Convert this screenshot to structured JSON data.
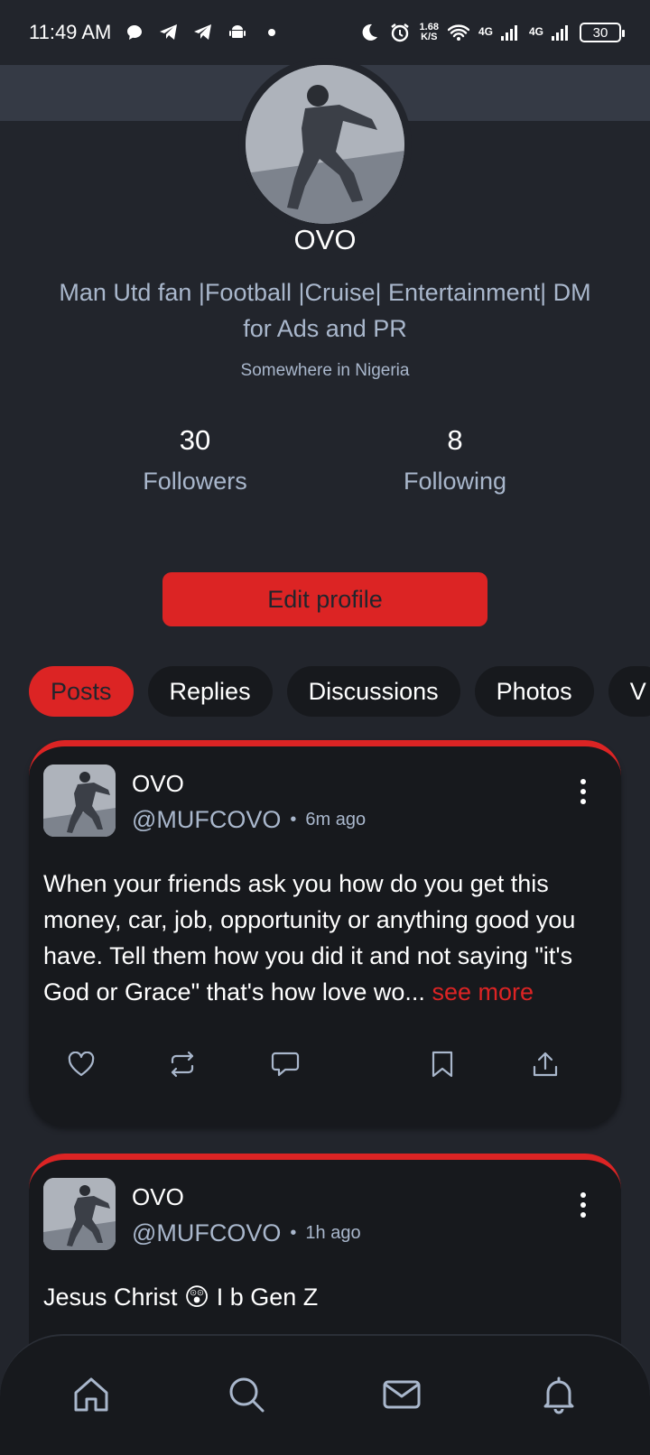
{
  "status_bar": {
    "time": "11:49 AM",
    "net_speed_value": "1.68",
    "net_speed_unit": "K/S",
    "sig1_label": "4G",
    "sig2_label": "4G",
    "battery": "30"
  },
  "profile": {
    "name": "OVO",
    "bio": "Man Utd fan |Football |Cruise| Entertainment| DM for Ads and PR",
    "location": "Somewhere in Nigeria",
    "followers_count": "30",
    "followers_label": "Followers",
    "following_count": "8",
    "following_label": "Following",
    "edit_label": "Edit profile"
  },
  "tabs": [
    {
      "label": "Posts",
      "active": true
    },
    {
      "label": "Replies",
      "active": false
    },
    {
      "label": "Discussions",
      "active": false
    },
    {
      "label": "Photos",
      "active": false
    },
    {
      "label": "V",
      "active": false
    }
  ],
  "posts": [
    {
      "name": "OVO",
      "handle": "@MUFCOVO",
      "separator": "•",
      "time": "6m ago",
      "text": "When your friends ask you how do you get this money, car, job, opportunity or anything good you have. Tell them how you did it and not saying \"it's God or Grace\" that's how love wo...",
      "see_more": "see more"
    },
    {
      "name": "OVO",
      "handle": "@MUFCOVO",
      "separator": "•",
      "time": "1h ago",
      "text": "Jesus Christ 😲 I b Gen Z"
    }
  ],
  "icons": {
    "accent": "#dc2424",
    "nav": [
      "home-icon",
      "search-icon",
      "mail-icon",
      "bell-icon"
    ],
    "actions": [
      "heart-icon",
      "repost-icon",
      "comment-icon",
      "bookmark-icon",
      "share-icon"
    ]
  }
}
